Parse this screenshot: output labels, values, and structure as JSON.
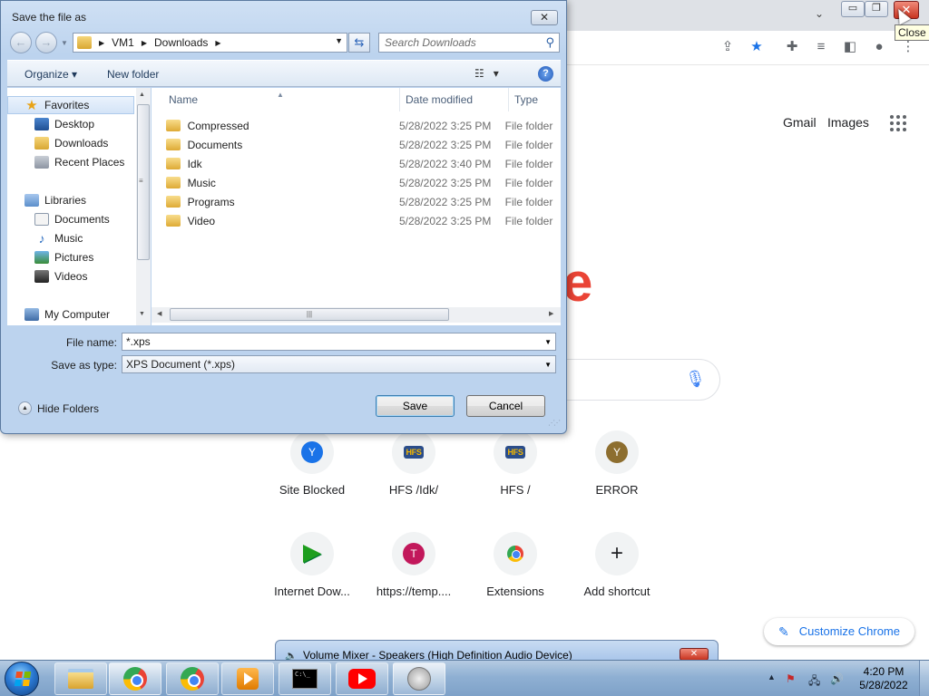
{
  "chrome": {
    "window_controls": {
      "minimize": "▭",
      "restore": "❐",
      "close": "✕"
    },
    "tooltip": "Close",
    "top_links": {
      "gmail": "Gmail",
      "images": "Images"
    },
    "shortcuts": [
      {
        "label": "Site Blocked",
        "icon": "avatar-Y",
        "letter": "Y",
        "color": "#1a73e8"
      },
      {
        "label": "HFS /Idk/",
        "icon": "hfs-icon",
        "badge": "HFS"
      },
      {
        "label": "HFS /",
        "icon": "hfs-icon",
        "badge": "HFS"
      },
      {
        "label": "ERROR",
        "icon": "avatar-Y",
        "letter": "Y",
        "color": "#8d6e2f"
      },
      {
        "label": "Internet Dow...",
        "icon": "play-arrow-icon"
      },
      {
        "label": "https://temp....",
        "icon": "avatar-T",
        "letter": "T",
        "color": "#c2185b"
      },
      {
        "label": "Extensions",
        "icon": "chrome-icon"
      },
      {
        "label": "Add shortcut",
        "icon": "plus-icon",
        "symbol": "+"
      }
    ],
    "customize_label": "Customize Chrome",
    "colors": {
      "accent": "#1a73e8",
      "logo_red": "#ea4335"
    }
  },
  "volume_mixer": {
    "title": "Volume Mixer - Speakers (High Definition Audio Device)",
    "close": "✕"
  },
  "dialog": {
    "title": "Save the file as",
    "close": "✕",
    "breadcrumb": [
      "VM1",
      "Downloads"
    ],
    "search_placeholder": "Search Downloads",
    "organize_label": "Organize ▾",
    "new_folder_label": "New folder",
    "help": "?",
    "nav": {
      "favorites_header": "Favorites",
      "favorites": [
        "Desktop",
        "Downloads",
        "Recent Places"
      ],
      "libraries_header": "Libraries",
      "libraries": [
        "Documents",
        "Music",
        "Pictures",
        "Videos"
      ],
      "computer": "My Computer"
    },
    "columns": {
      "name": "Name",
      "date": "Date modified",
      "type": "Type"
    },
    "files": [
      {
        "name": "Compressed",
        "date": "5/28/2022 3:25 PM",
        "type": "File folder"
      },
      {
        "name": "Documents",
        "date": "5/28/2022 3:25 PM",
        "type": "File folder"
      },
      {
        "name": "Idk",
        "date": "5/28/2022 3:40 PM",
        "type": "File folder"
      },
      {
        "name": "Music",
        "date": "5/28/2022 3:25 PM",
        "type": "File folder"
      },
      {
        "name": "Programs",
        "date": "5/28/2022 3:25 PM",
        "type": "File folder"
      },
      {
        "name": "Video",
        "date": "5/28/2022 3:25 PM",
        "type": "File folder"
      }
    ],
    "file_name_label": "File name:",
    "file_name_value": "*.xps",
    "save_type_label": "Save as type:",
    "save_type_value": "XPS Document (*.xps)",
    "hide_folders_label": "Hide Folders",
    "save_label": "Save",
    "cancel_label": "Cancel"
  },
  "taskbar": {
    "clock_time": "4:20 PM",
    "clock_date": "5/28/2022",
    "cmd_text": "C:\\_"
  }
}
